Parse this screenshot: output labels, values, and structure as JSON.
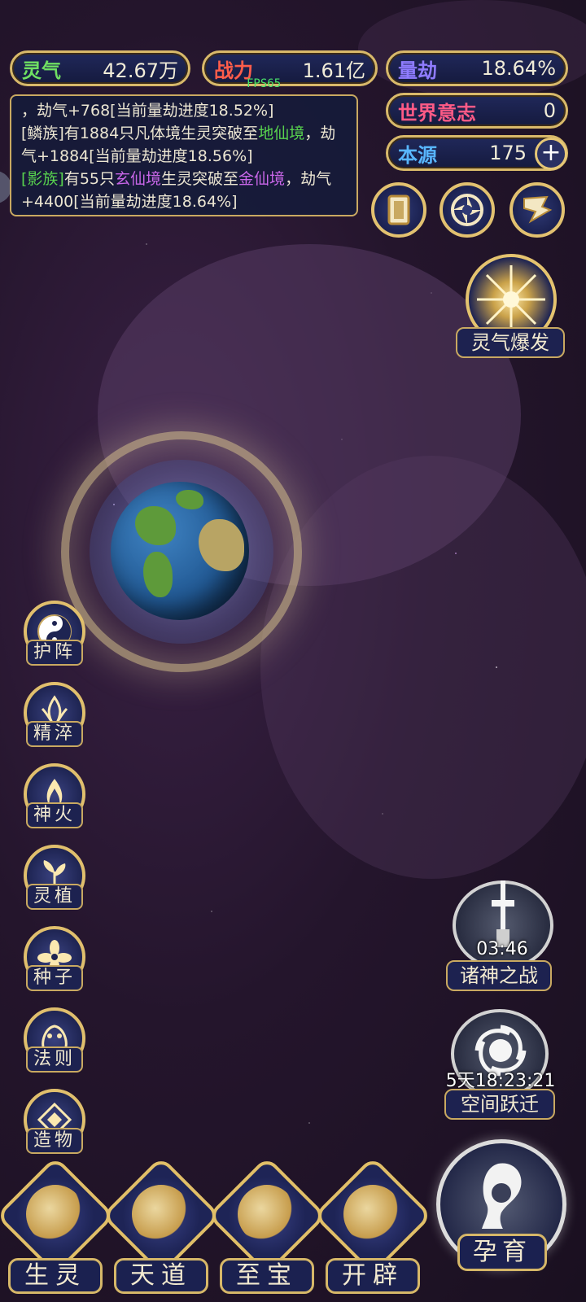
{
  "resources": {
    "lingqi": {
      "label": "灵气",
      "value": "42.67万"
    },
    "zhanli": {
      "label": "战力",
      "value": "1.61亿"
    },
    "liangjie": {
      "label": "量劫",
      "value": "18.64%"
    },
    "shijie_yizhi": {
      "label": "世界意志",
      "value": "0"
    },
    "benyuan": {
      "label": "本源",
      "value": "175",
      "add": "+"
    }
  },
  "fps": "FPS65",
  "log": {
    "line1": "，劫气+768[当前量劫进度18.52%]",
    "entry2": {
      "prefix": "[鳞族]有1884只凡体境生灵突破至",
      "highlight": "地仙境",
      "suffix": "，劫气+1884[当前量劫进度18.56%]"
    },
    "entry3": {
      "tag": "[影族]",
      "mid": "有55只",
      "hl1": "玄仙境",
      "mid2": "生灵突破至",
      "hl2": "金仙境",
      "suffix": "，劫气+4400[当前量劫进度18.64%]"
    }
  },
  "right_panel": {
    "lingqi_baofa": "灵气爆发",
    "zhushen": {
      "timer": "03:46",
      "label": "诸神之战"
    },
    "kongjian": {
      "timer": "5天18:23:21",
      "label": "空间跃迁"
    }
  },
  "left_menu": [
    {
      "label": "护阵"
    },
    {
      "label": "精淬"
    },
    {
      "label": "神火"
    },
    {
      "label": "灵植"
    },
    {
      "label": "种子"
    },
    {
      "label": "法则"
    },
    {
      "label": "造物"
    }
  ],
  "bottom_nav": [
    {
      "label": "生灵"
    },
    {
      "label": "天道"
    },
    {
      "label": "至宝"
    },
    {
      "label": "开辟"
    }
  ],
  "main_button": "孕育",
  "colors": {
    "gold": "#d8b96a",
    "panel": "#1d2250",
    "green": "#58d34e",
    "purple": "#c866e8"
  }
}
